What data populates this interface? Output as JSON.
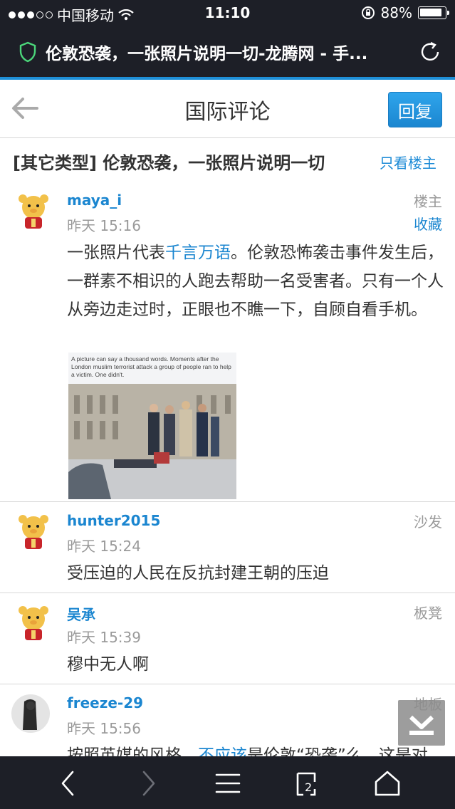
{
  "status_bar": {
    "carrier": "中国移动",
    "time": "11:10",
    "battery": "88%"
  },
  "browser": {
    "page_title": "伦敦恐袭，一张照片说明一切-龙腾网 - 手...",
    "tabs_count": "2"
  },
  "header": {
    "title": "国际评论",
    "reply_label": "回复"
  },
  "thread": {
    "title": "[其它类型] 伦敦恐袭，一张照片说明一切",
    "only_op_label": "只看楼主"
  },
  "posts": [
    {
      "username": "maya_i",
      "time": "昨天 15:16",
      "floor": "楼主",
      "favorite": "收藏",
      "body_before": "一张照片代表",
      "body_link": "千言万语",
      "body_after": "。伦敦恐怖袭击事件发生后，一群素不相识的人跑去帮助一名受害者。只有一个人从旁边走过时，正眼也不瞧一下，自顾自看手机。",
      "image_caption": "A picture can say a thousand words. Moments after the London muslim terrorist attack a group of people ran to help a victim. One didn't."
    },
    {
      "username": "hunter2015",
      "time": "昨天 15:24",
      "floor": "沙发",
      "body": "受压迫的人民在反抗封建王朝的压迫"
    },
    {
      "username": "吴承",
      "time": "昨天 15:39",
      "floor": "板凳",
      "body": "穆中无人啊"
    },
    {
      "username": "freeze-29",
      "time": "昨天 15:56",
      "floor": "地板",
      "body_before": "按照英媒的风格，",
      "body_link": "不应该",
      "body_after": "是伦敦“恐袭”么，这是对"
    }
  ]
}
